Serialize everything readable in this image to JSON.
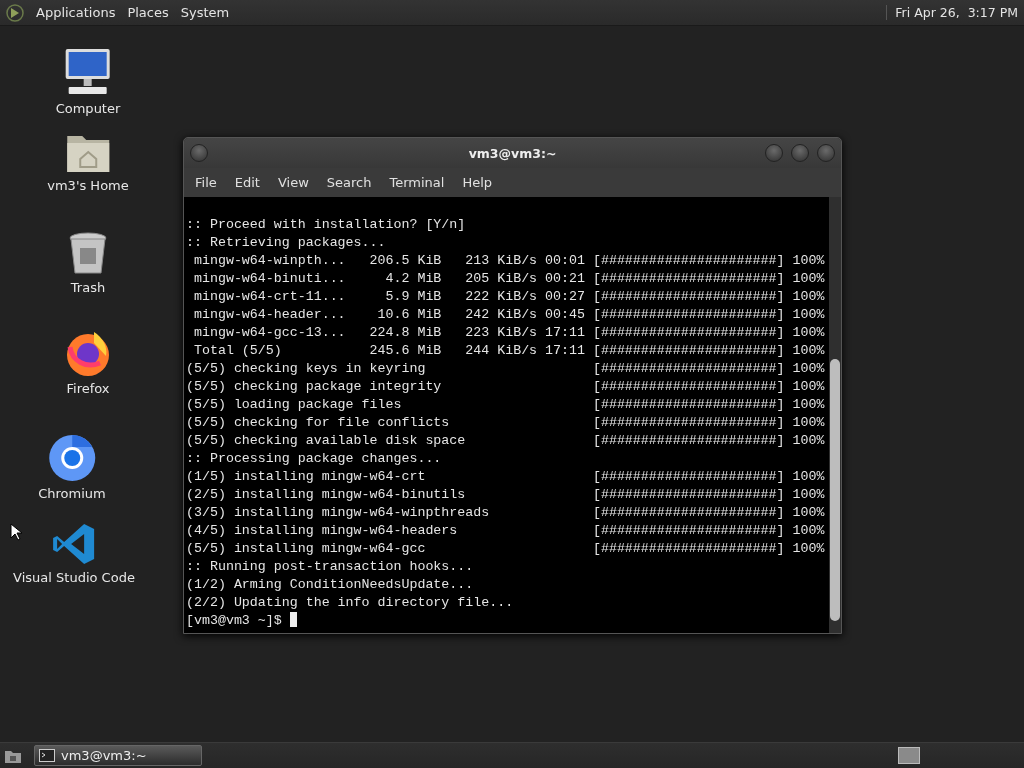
{
  "top_panel": {
    "menus": [
      "Applications",
      "Places",
      "System"
    ],
    "clock": "Fri Apr 26,  3:17 PM"
  },
  "desktop_icons": [
    {
      "label": "Computer",
      "kind": "computer"
    },
    {
      "label": "vm3's Home",
      "kind": "home"
    },
    {
      "label": "Trash",
      "kind": "trash"
    },
    {
      "label": "Firefox",
      "kind": "firefox"
    },
    {
      "label": "Chromium",
      "kind": "chromium"
    },
    {
      "label": "Visual Studio Code",
      "kind": "vscode"
    }
  ],
  "terminal_window": {
    "title": "vm3@vm3:~",
    "menu": [
      "File",
      "Edit",
      "View",
      "Search",
      "Terminal",
      "Help"
    ],
    "lines": [
      ":: Proceed with installation? [Y/n]",
      ":: Retrieving packages...",
      " mingw-w64-winpth...   206.5 KiB   213 KiB/s 00:01 [######################] 100%",
      " mingw-w64-binuti...     4.2 MiB   205 KiB/s 00:21 [######################] 100%",
      " mingw-w64-crt-11...     5.9 MiB   222 KiB/s 00:27 [######################] 100%",
      " mingw-w64-header...    10.6 MiB   242 KiB/s 00:45 [######################] 100%",
      " mingw-w64-gcc-13...   224.8 MiB   223 KiB/s 17:11 [######################] 100%",
      " Total (5/5)           245.6 MiB   244 KiB/s 17:11 [######################] 100%",
      "(5/5) checking keys in keyring                     [######################] 100%",
      "(5/5) checking package integrity                   [######################] 100%",
      "(5/5) loading package files                        [######################] 100%",
      "(5/5) checking for file conflicts                  [######################] 100%",
      "(5/5) checking available disk space                [######################] 100%",
      ":: Processing package changes...",
      "(1/5) installing mingw-w64-crt                     [######################] 100%",
      "(2/5) installing mingw-w64-binutils                [######################] 100%",
      "(3/5) installing mingw-w64-winpthreads             [######################] 100%",
      "(4/5) installing mingw-w64-headers                 [######################] 100%",
      "(5/5) installing mingw-w64-gcc                     [######################] 100%",
      ":: Running post-transaction hooks...",
      "(1/2) Arming ConditionNeedsUpdate...",
      "(2/2) Updating the info directory file..."
    ],
    "prompt": "[vm3@vm3 ~]$"
  },
  "taskbar": {
    "tasks": [
      {
        "label": "vm3@vm3:~"
      }
    ]
  }
}
